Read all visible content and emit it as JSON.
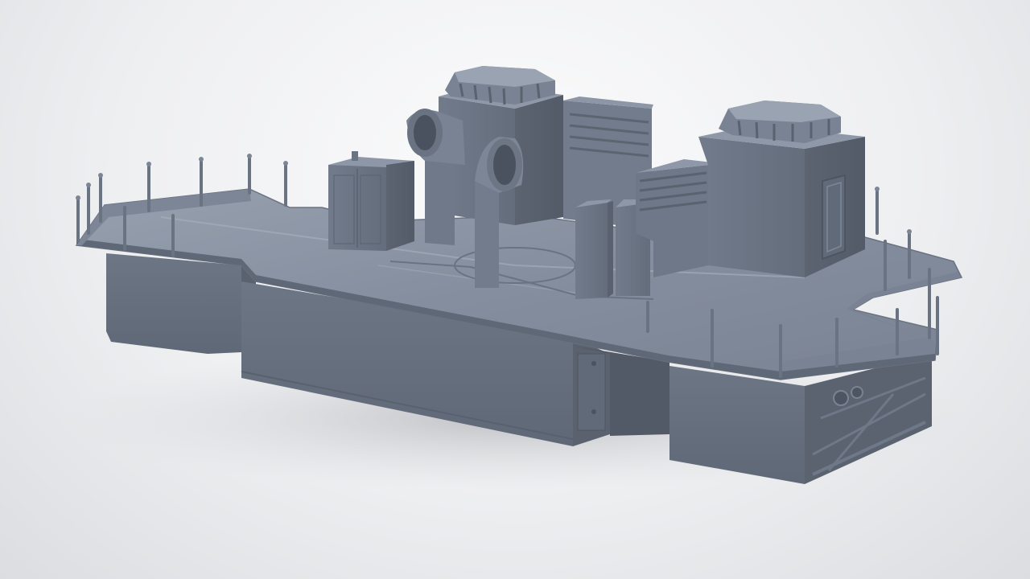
{
  "scene": {
    "subject": "",
    "colors": {
      "background": "#ececee",
      "model_base": "#6f7888",
      "model_light": "#8e97a7",
      "model_dark": "#535b69",
      "deck_top": "#8a93a3",
      "shadow": "#c9cacd"
    }
  }
}
